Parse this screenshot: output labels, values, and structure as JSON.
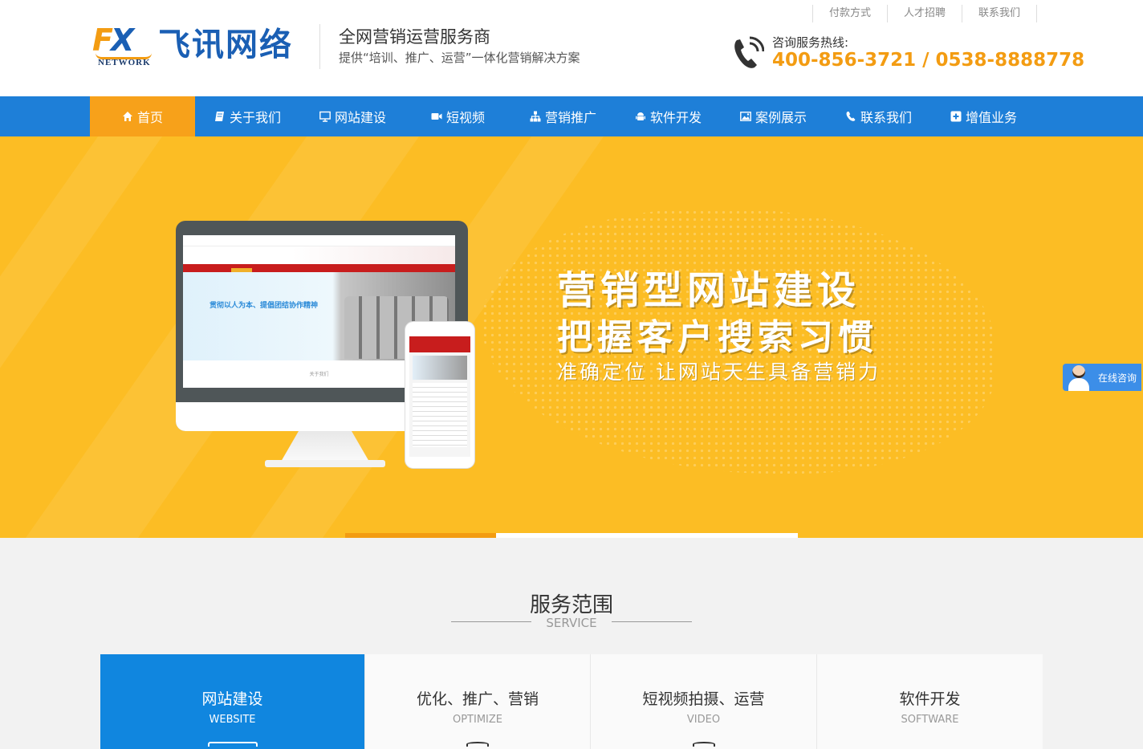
{
  "top_links": [
    "付款方式",
    "人才招聘",
    "联系我们"
  ],
  "logo": {
    "mark_f": "F",
    "mark_x": "X",
    "network": "NETWORK",
    "name": "飞讯网络"
  },
  "slogan": {
    "main": "全网营销运营服务商",
    "sub": "提供“培训、推广、运营”一体化营销解决方案"
  },
  "hotline": {
    "label": "咨询服务热线:",
    "number": "400-856-3721 / 0538-8888778",
    "icon": "phone-icon"
  },
  "nav": {
    "items": [
      {
        "label": "首页",
        "icon": "home-icon",
        "active": true
      },
      {
        "label": "关于我们",
        "icon": "book-icon"
      },
      {
        "label": "网站建设",
        "icon": "monitor-icon"
      },
      {
        "label": "短视频",
        "icon": "video-camera-icon"
      },
      {
        "label": "营销推广",
        "icon": "sitemap-icon"
      },
      {
        "label": "软件开发",
        "icon": "android-icon"
      },
      {
        "label": "案例展示",
        "icon": "image-icon"
      },
      {
        "label": "联系我们",
        "icon": "phone-icon"
      },
      {
        "label": "增值业务",
        "icon": "plus-square-icon"
      }
    ]
  },
  "banner": {
    "title1": "营销型网站建设",
    "title2": "把握客户搜索习惯",
    "subtitle": "准确定位 让网站天生具备营销力",
    "screen_text": "贯彻以人为本、提倡团结协作精神",
    "screen_footer": "关于我们",
    "background_color": "#fcbd24",
    "slider_active_index": 0,
    "slider_count": 3
  },
  "float_service": {
    "label": "在线咨询"
  },
  "service": {
    "title": "服务范围",
    "subtitle": "SERVICE",
    "cards": [
      {
        "cn": "网站建设",
        "en": "WEBSITE",
        "active": true
      },
      {
        "cn": "优化、推广、营销",
        "en": "OPTIMIZE"
      },
      {
        "cn": "短视频拍摄、运营",
        "en": "VIDEO"
      },
      {
        "cn": "软件开发",
        "en": "SOFTWARE"
      }
    ]
  },
  "colors": {
    "brand_blue": "#1e7fd8",
    "accent_orange": "#f7a11a",
    "hotline_orange": "#f39c12",
    "card_active": "#1086df"
  }
}
